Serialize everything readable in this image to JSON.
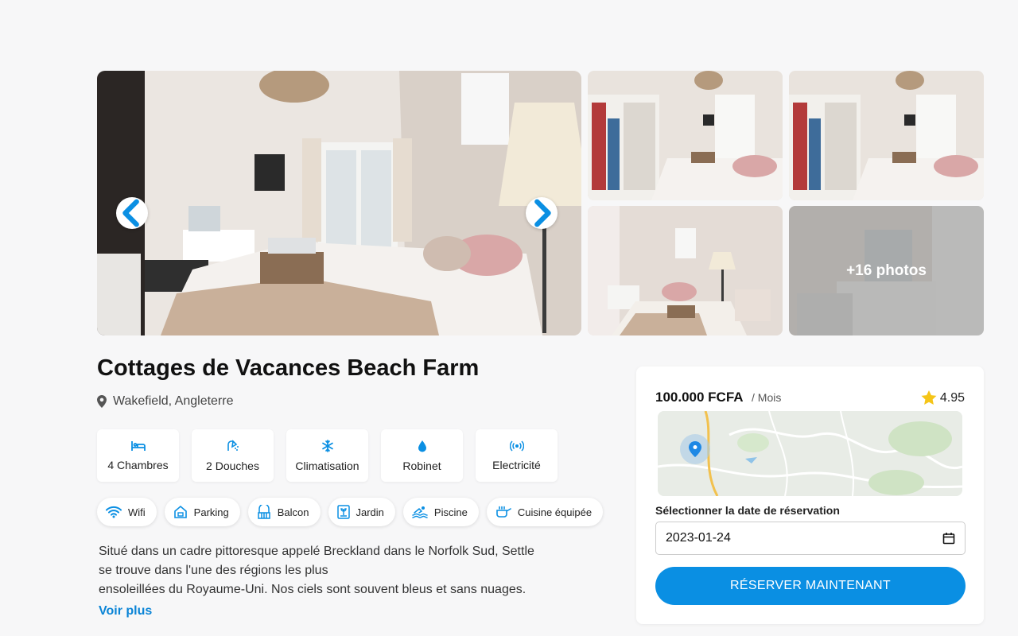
{
  "gallery": {
    "more_photos_label": "+16 photos",
    "prev_icon": "chevron-left-icon",
    "next_icon": "chevron-right-icon"
  },
  "property": {
    "title": "Cottages de Vacances Beach Farm",
    "location": "Wakefield, Angleterre",
    "location_icon": "map-pin-icon"
  },
  "features": [
    {
      "label": "4 Chambres",
      "icon": "bed-icon"
    },
    {
      "label": "2 Douches",
      "icon": "shower-icon"
    },
    {
      "label": "Climatisation",
      "icon": "snowflake-icon"
    },
    {
      "label": "Robinet",
      "icon": "water-drop-icon"
    },
    {
      "label": "Electricité",
      "icon": "electricity-icon"
    }
  ],
  "amenities": [
    {
      "label": "Wifi",
      "icon": "wifi-icon"
    },
    {
      "label": "Parking",
      "icon": "parking-icon"
    },
    {
      "label": "Balcon",
      "icon": "balcony-icon"
    },
    {
      "label": "Jardin",
      "icon": "garden-icon"
    },
    {
      "label": "Piscine",
      "icon": "pool-icon"
    },
    {
      "label": "Cuisine équipée",
      "icon": "kitchen-icon"
    }
  ],
  "description": {
    "lines": [
      "Situé dans un cadre pittoresque appelé Breckland dans le Norfolk Sud, Settle",
      "se trouve dans l'une des régions les plus",
      "ensoleillées du Royaume-Uni. Nos ciels sont souvent bleus et sans nuages."
    ],
    "see_more": "Voir plus"
  },
  "booking": {
    "price": "100.000 FCFA",
    "period": "/ Mois",
    "rating": "4.95",
    "date_label": "Sélectionner la date de réservation",
    "date_value": "2023-01-24",
    "book_button": "RÉSERVER MAINTENANT"
  },
  "colors": {
    "accent": "#0a8fe3",
    "star": "#f5c518"
  }
}
